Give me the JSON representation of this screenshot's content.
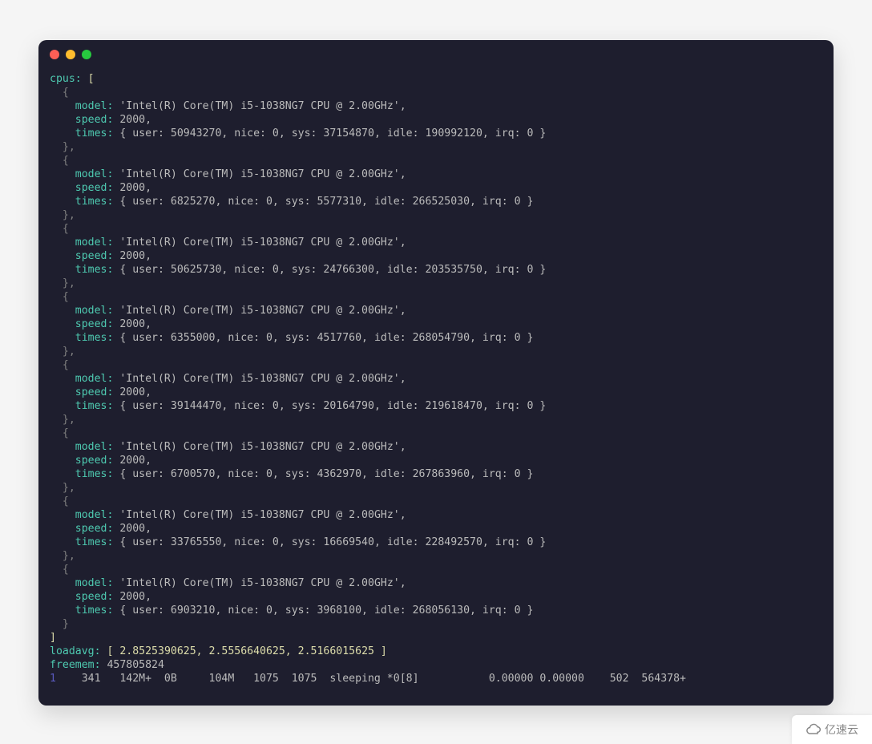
{
  "term": {
    "cpusLabel": "cpus:",
    "openArr": "[",
    "closeArr": "]",
    "openObj": "{",
    "closeObj": "}",
    "closeObjComma": "},",
    "modelLabel": "model:",
    "speedLabel": "speed:",
    "timesLabel": "times:",
    "cpus": [
      {
        "model": "'Intel(R) Core(TM) i5-1038NG7 CPU @ 2.00GHz'",
        "speed": "2000",
        "times": "{ user: 50943270, nice: 0, sys: 37154870, idle: 190992120, irq: 0 }"
      },
      {
        "model": "'Intel(R) Core(TM) i5-1038NG7 CPU @ 2.00GHz'",
        "speed": "2000",
        "times": "{ user: 6825270, nice: 0, sys: 5577310, idle: 266525030, irq: 0 }"
      },
      {
        "model": "'Intel(R) Core(TM) i5-1038NG7 CPU @ 2.00GHz'",
        "speed": "2000",
        "times": "{ user: 50625730, nice: 0, sys: 24766300, idle: 203535750, irq: 0 }"
      },
      {
        "model": "'Intel(R) Core(TM) i5-1038NG7 CPU @ 2.00GHz'",
        "speed": "2000",
        "times": "{ user: 6355000, nice: 0, sys: 4517760, idle: 268054790, irq: 0 }"
      },
      {
        "model": "'Intel(R) Core(TM) i5-1038NG7 CPU @ 2.00GHz'",
        "speed": "2000",
        "times": "{ user: 39144470, nice: 0, sys: 20164790, idle: 219618470, irq: 0 }"
      },
      {
        "model": "'Intel(R) Core(TM) i5-1038NG7 CPU @ 2.00GHz'",
        "speed": "2000",
        "times": "{ user: 6700570, nice: 0, sys: 4362970, idle: 267863960, irq: 0 }"
      },
      {
        "model": "'Intel(R) Core(TM) i5-1038NG7 CPU @ 2.00GHz'",
        "speed": "2000",
        "times": "{ user: 33765550, nice: 0, sys: 16669540, idle: 228492570, irq: 0 }"
      },
      {
        "model": "'Intel(R) Core(TM) i5-1038NG7 CPU @ 2.00GHz'",
        "speed": "2000",
        "times": "{ user: 6903210, nice: 0, sys: 3968100, idle: 268056130, irq: 0 }"
      }
    ],
    "loadavgLabel": "loadavg:",
    "loadavgArr": "[ 2.8525390625, 2.5556640625, 2.5166015625 ]",
    "freememLabel": "freemem:",
    "freememVal": "457805824",
    "procLine": {
      "one": "1",
      "rest": "    341   142M+  0B     104M   1075  1075  sleeping *0[8]           0.00000 0.00000    502  564378+"
    }
  },
  "watermark": {
    "text": "亿速云"
  }
}
